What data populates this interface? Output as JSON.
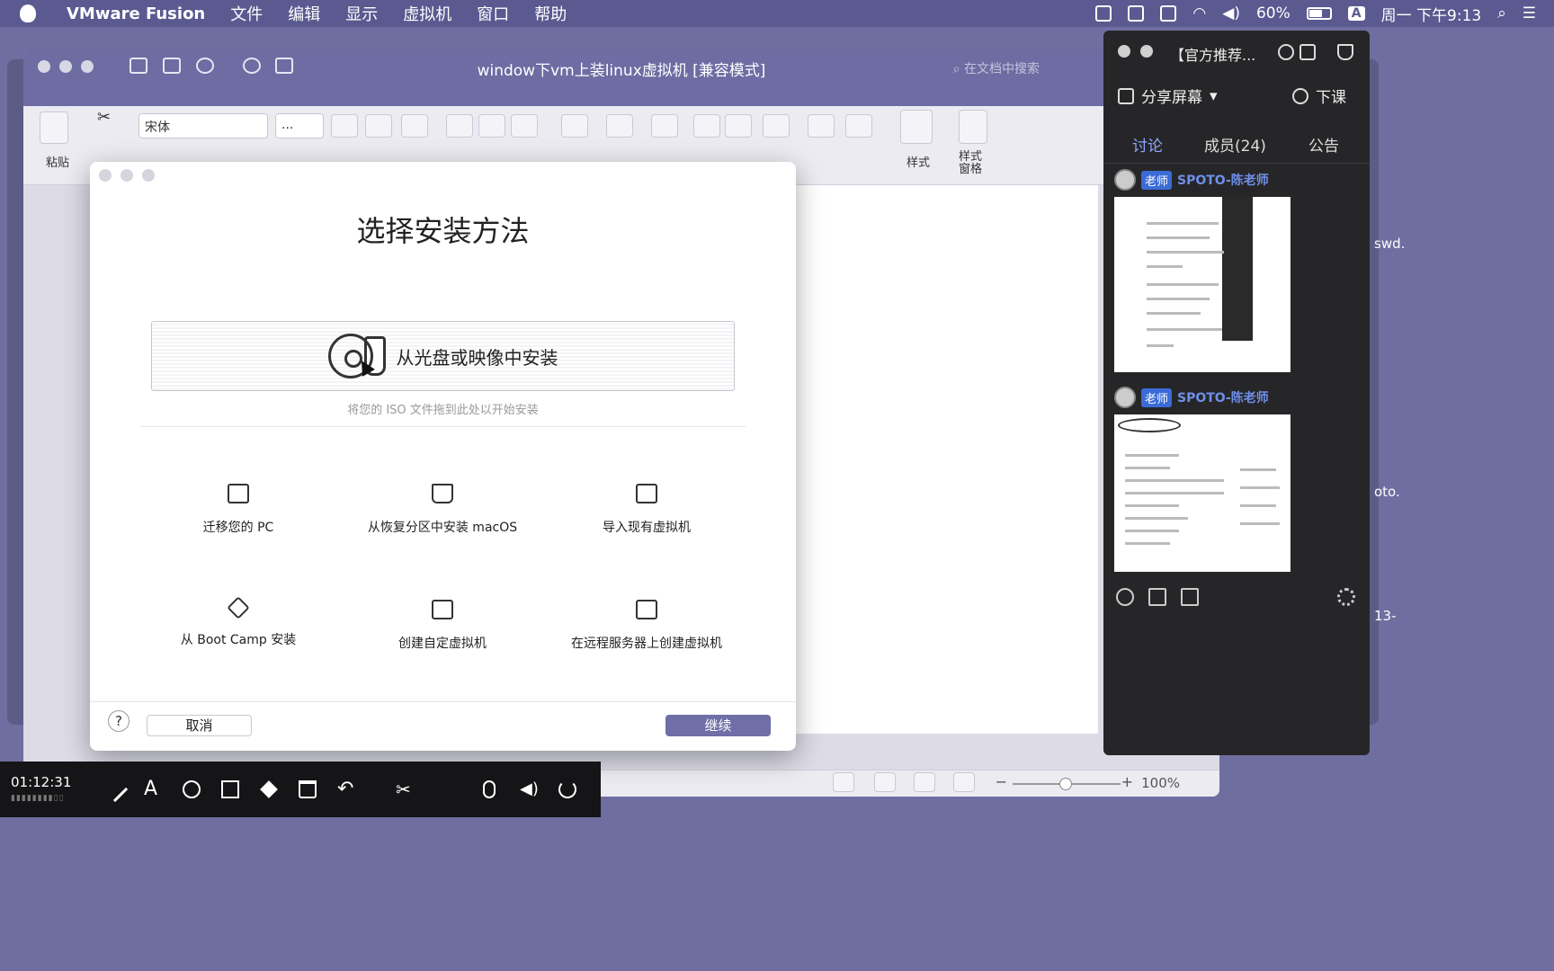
{
  "menubar": {
    "app_name": "VMware Fusion",
    "menus": [
      "文件",
      "编辑",
      "显示",
      "虚拟机",
      "窗口",
      "帮助"
    ],
    "battery": "60%",
    "input_method": "A",
    "datetime": "周一 下午9:13"
  },
  "word": {
    "title": "window下vm上装linux虚拟机 [兼容模式]",
    "search_placeholder": "在文档中搜索",
    "paste_label": "粘贴",
    "font_name": "宋体",
    "font_size": "...",
    "styles_label": "样式",
    "styles_pane_label": "样式\n窗格",
    "zoom": "100%"
  },
  "dialog": {
    "title": "选择安装方法",
    "dropzone_label": "从光盘或映像中安装",
    "drop_hint": "将您的 ISO 文件拖到此处以开始安装",
    "options": [
      {
        "label": "迁移您的 PC",
        "icon": "migrate-pc-icon"
      },
      {
        "label": "从恢复分区中安装 macOS",
        "icon": "disk-drive-icon"
      },
      {
        "label": "导入现有虚拟机",
        "icon": "import-vm-icon"
      },
      {
        "label": "从 Boot Camp 安装",
        "icon": "bootcamp-icon"
      },
      {
        "label": "创建自定虚拟机",
        "icon": "custom-vm-icon"
      },
      {
        "label": "在远程服务器上创建虚拟机",
        "icon": "remote-server-icon"
      }
    ],
    "help": "?",
    "cancel": "取消",
    "continue": "继续"
  },
  "panel": {
    "title": "【官方推荐...",
    "share_screen": "分享屏幕",
    "end_class": "下课",
    "tabs": [
      "讨论",
      "成员(24)",
      "公告"
    ],
    "messages": [
      {
        "role": "老师",
        "sender": "SPOTO-陈老师"
      },
      {
        "role": "老师",
        "sender": "SPOTO-陈老师"
      }
    ]
  },
  "right_edge_text": [
    "swd.",
    "oto.",
    "13-"
  ],
  "recorder": {
    "time": "01:12:31"
  },
  "colors": {
    "accent": "#6f6ea6",
    "menubar": "#5a5990",
    "panel_bg": "#262628",
    "tab_active": "#8fa7ff",
    "sender": "#6f8fe8"
  }
}
